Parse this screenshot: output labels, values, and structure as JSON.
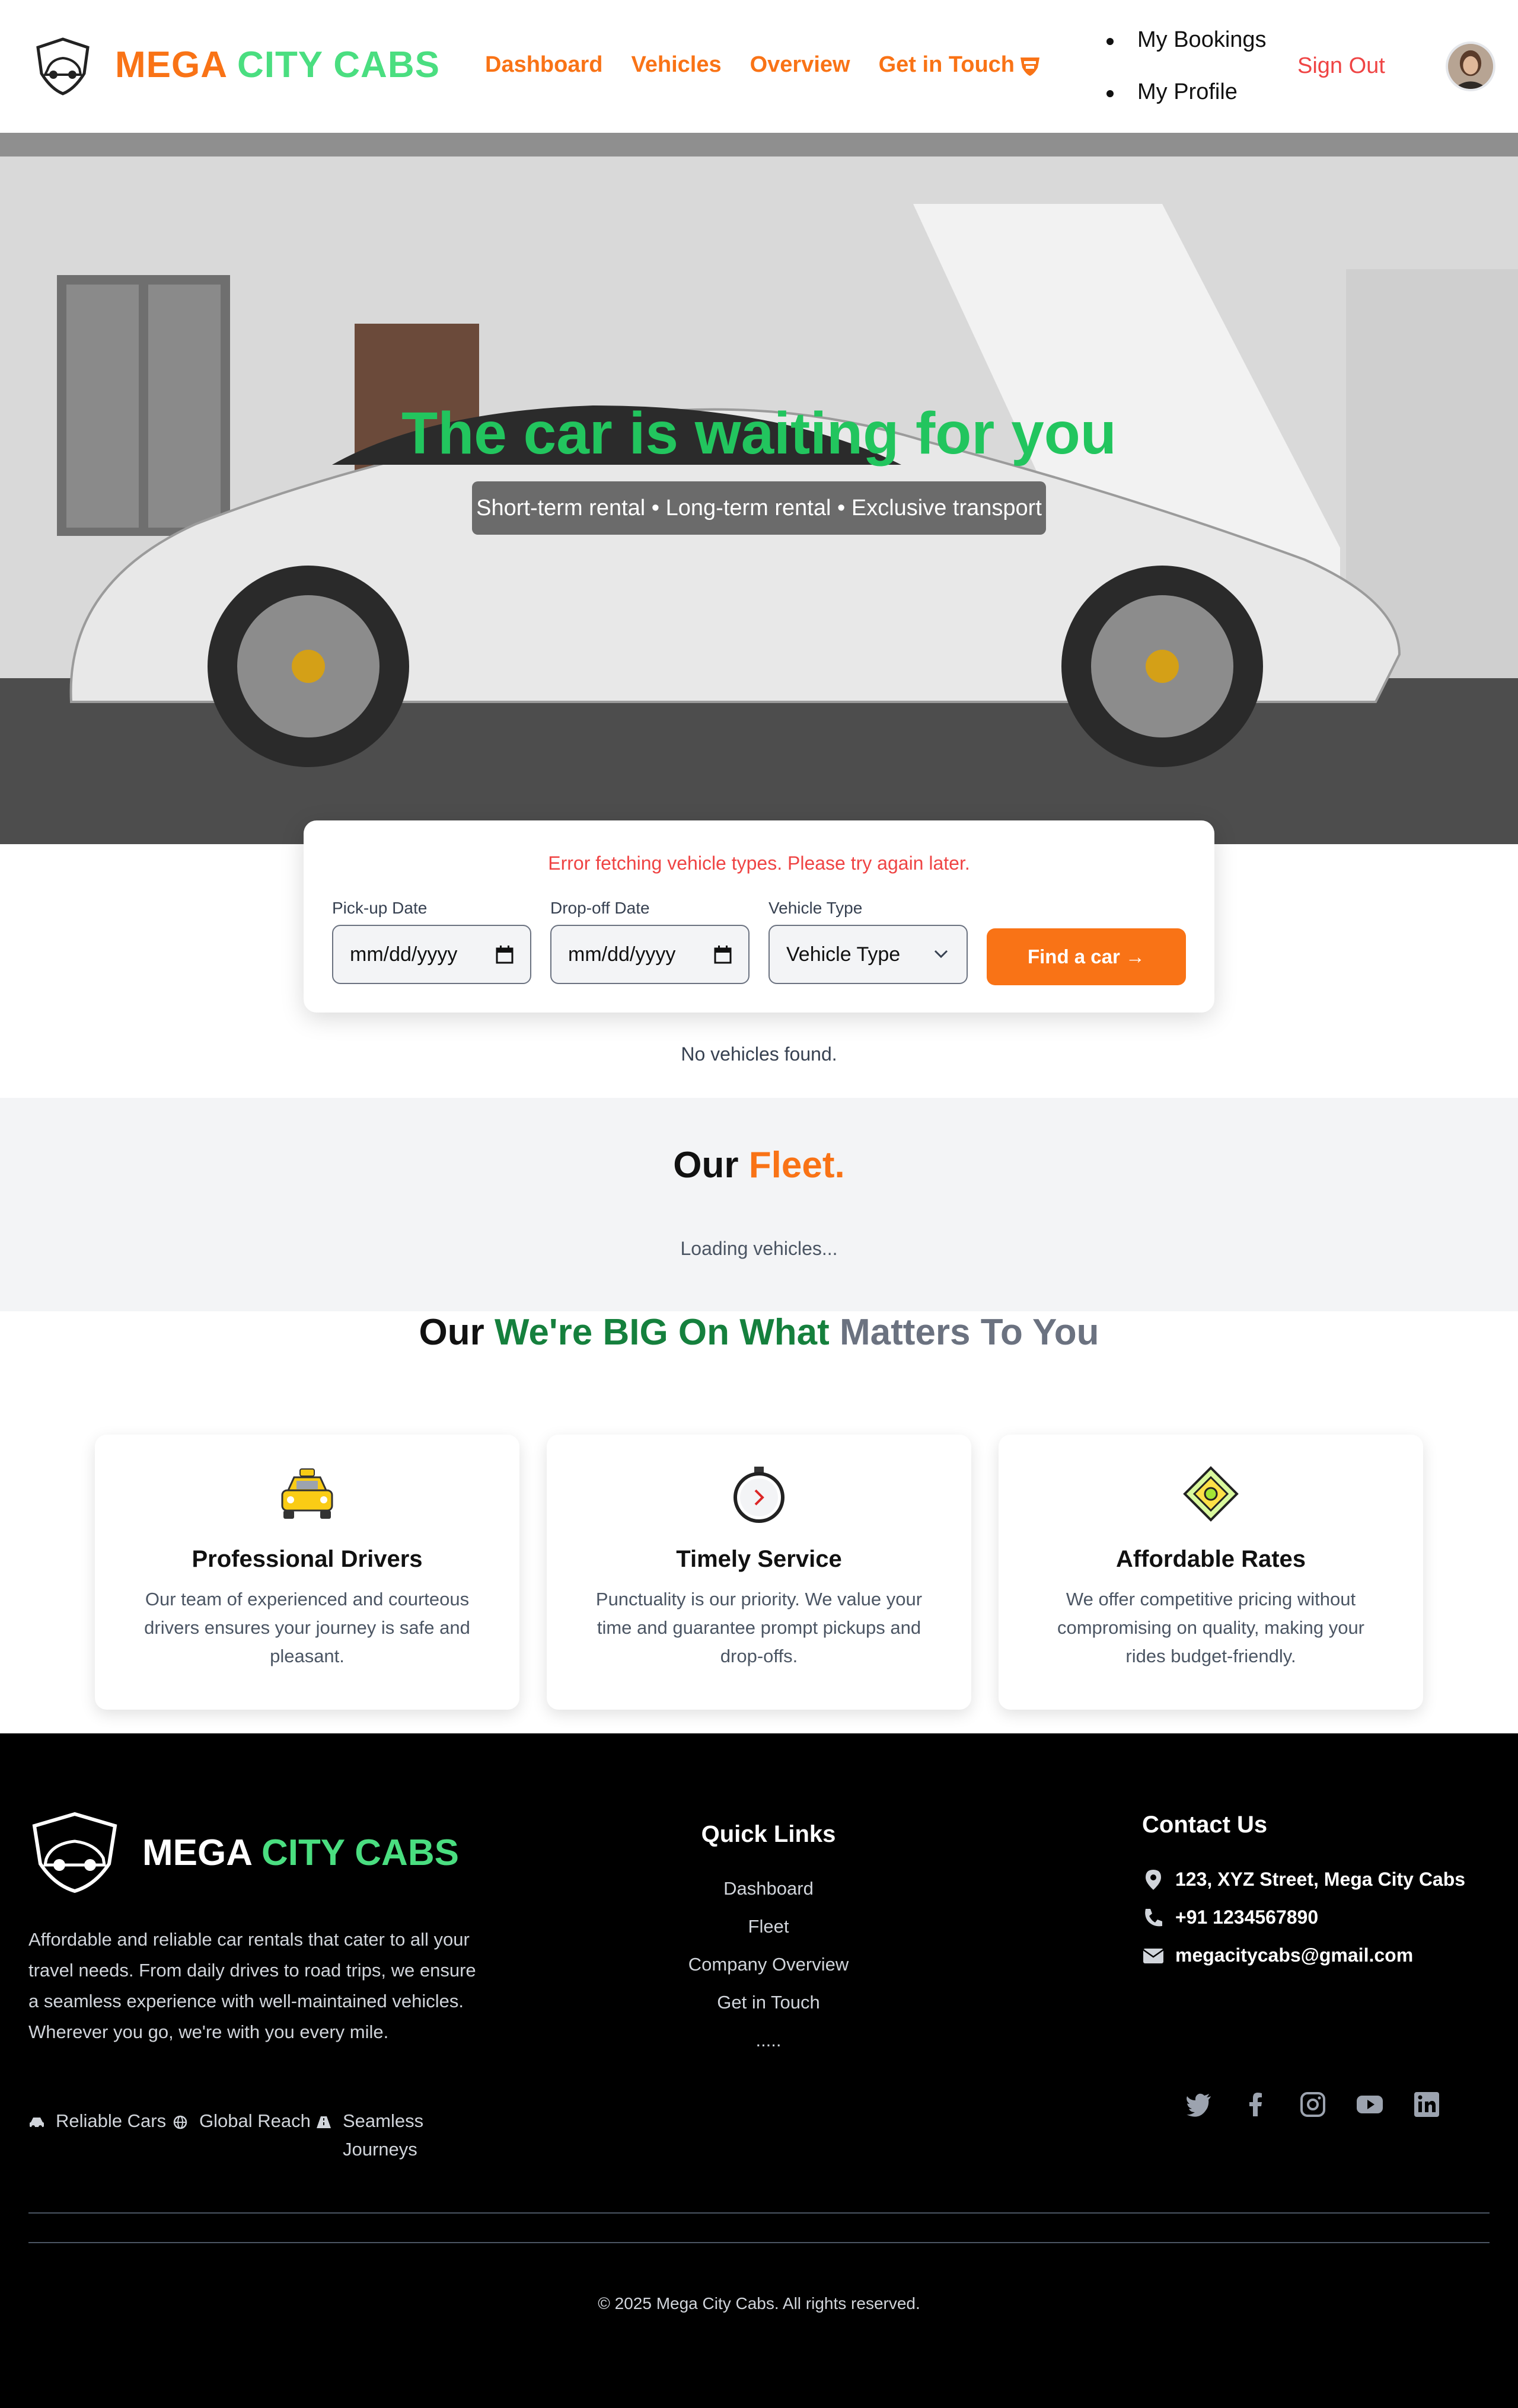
{
  "brand": {
    "part1": "MEGA",
    "part2": "CITY CABS"
  },
  "nav": {
    "links": [
      "Dashboard",
      "Vehicles",
      "Overview",
      "Get in Touch"
    ],
    "user_menu": [
      "My Bookings",
      "My Profile"
    ],
    "sign_out": "Sign Out"
  },
  "hero": {
    "title": "The car is waiting for you",
    "subtitle": "Short-term rental • Long-term rental • Exclusive transport"
  },
  "search": {
    "error": "Error fetching vehicle types. Please try again later.",
    "pickup_label": "Pick-up Date",
    "pickup_value": "mm/dd/yyyy",
    "dropoff_label": "Drop-off Date",
    "dropoff_value": "mm/dd/yyyy",
    "type_label": "Vehicle Type",
    "type_value": "Vehicle Type",
    "button": "Find a car →",
    "no_results": "No vehicles found."
  },
  "fleet": {
    "title_a": "Our",
    "title_b": "Fleet.",
    "loading": "Loading vehicles..."
  },
  "features": {
    "title_a": "Our",
    "title_b": "We're BIG On What",
    "title_c": "Matters To You",
    "cards": [
      {
        "icon": "taxi-icon",
        "title": "Professional Drivers",
        "text": "Our team of experienced and courteous drivers ensures your journey is safe and pleasant."
      },
      {
        "icon": "stopwatch-icon",
        "title": "Timely Service",
        "text": "Punctuality is our priority. We value your time and guarantee prompt pickups and drop-offs."
      },
      {
        "icon": "money-icon",
        "title": "Affordable Rates",
        "text": "We offer competitive pricing without compromising on quality, making your rides budget-friendly."
      }
    ]
  },
  "footer": {
    "brand1": "MEGA",
    "brand2": "CITY CABS",
    "description": "Affordable and reliable car rentals that cater to all your travel needs. From daily drives to road trips, we ensure a seamless experience with well-maintained vehicles. Wherever you go, we're with you every mile.",
    "features": [
      "Reliable Cars",
      "Global Reach",
      "Seamless Journeys"
    ],
    "quick_links_title": "Quick Links",
    "quick_links": [
      "Dashboard",
      "Fleet",
      "Company Overview",
      "Get in Touch",
      "....."
    ],
    "contact_title": "Contact Us",
    "address": "123, XYZ Street, Mega City Cabs",
    "phone": "+91 1234567890",
    "email": "megacitycabs@gmail.com",
    "social": [
      "twitter-icon",
      "facebook-icon",
      "instagram-icon",
      "youtube-icon",
      "linkedin-icon"
    ],
    "copyright": "© 2025 Mega City Cabs. All rights reserved."
  },
  "colors": {
    "orange": "#f97316",
    "green": "#22c55e",
    "dark_green": "#15803d",
    "red": "#ef4444"
  }
}
